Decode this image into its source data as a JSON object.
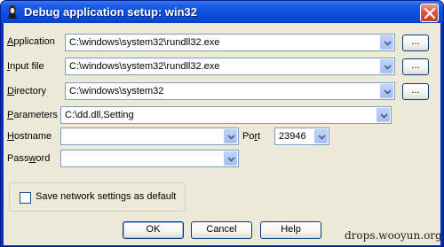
{
  "window": {
    "title": "Debug application setup: win32",
    "close_label": "Close"
  },
  "fields": {
    "application": {
      "label_pre": "",
      "label_accel": "A",
      "label_post": "pplication",
      "value": "C:\\windows\\system32\\rundll32.exe",
      "browse_label": "..."
    },
    "input_file": {
      "label_pre": "",
      "label_accel": "I",
      "label_post": "nput file",
      "value": "C:\\windows\\system32\\rundll32.exe",
      "browse_label": "..."
    },
    "directory": {
      "label_pre": "",
      "label_accel": "D",
      "label_post": "irectory",
      "value": "C:\\windows\\system32",
      "browse_label": "..."
    },
    "parameters": {
      "label_pre": "",
      "label_accel": "P",
      "label_post": "arameters",
      "value": "C:\\dd.dll,Setting"
    },
    "hostname": {
      "label_pre": "",
      "label_accel": "H",
      "label_post": "ostname",
      "value": ""
    },
    "port": {
      "label_pre": "Po",
      "label_accel": "r",
      "label_post": "t",
      "value": "23946"
    },
    "password": {
      "label_pre": "Pass",
      "label_accel": "w",
      "label_post": "ord",
      "value": ""
    }
  },
  "save_settings": {
    "label": "Save network settings as default",
    "checked": false
  },
  "buttons": {
    "ok": "OK",
    "cancel": "Cancel",
    "help": "Help"
  },
  "watermark": "drops.wooyun.org",
  "colors": {
    "titlebar": "#0b4fe0",
    "dialog_bg": "#ece9d8",
    "field_border": "#7f9db9",
    "close_button": "#d9573a"
  }
}
